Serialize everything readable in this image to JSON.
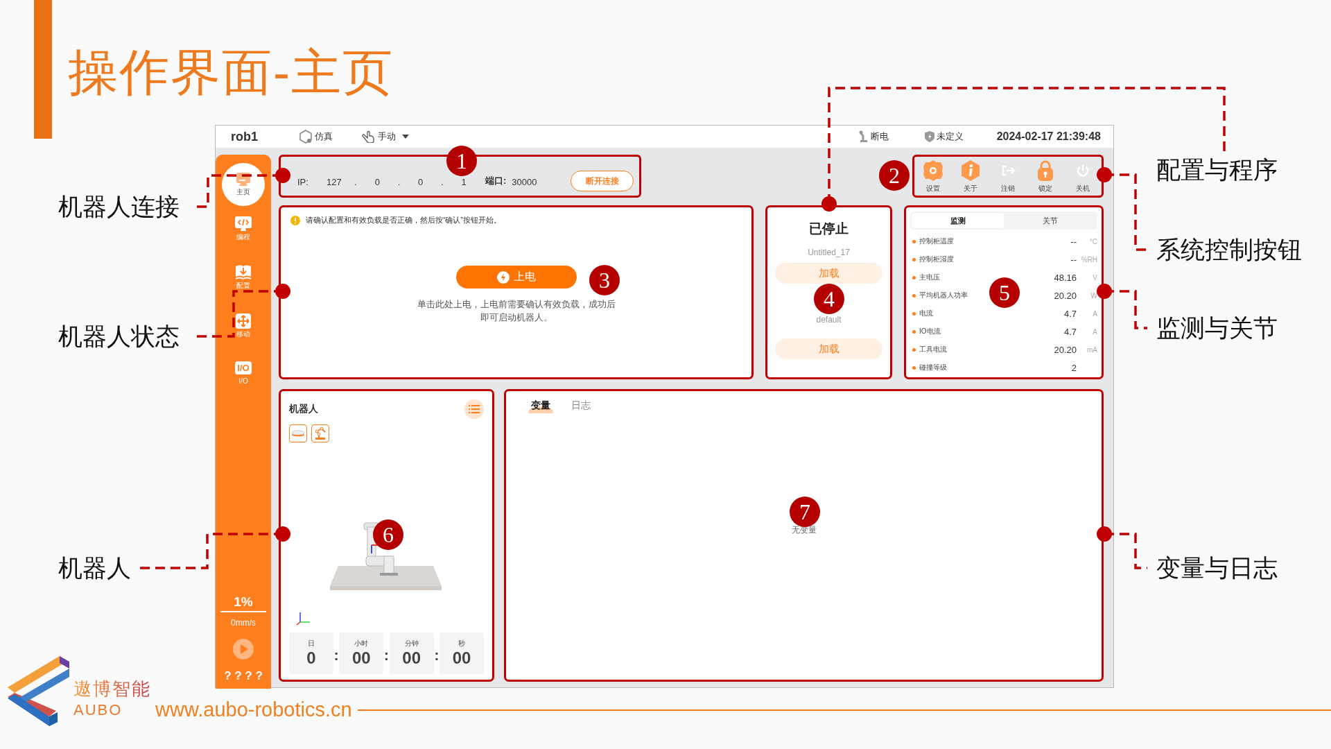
{
  "slide": {
    "title": "操作界面-主页",
    "brand_cn": "遨博智能",
    "brand_en": "AUBO",
    "website": "www.aubo-robotics.cn"
  },
  "annotations": [
    {
      "label": "机器人连接"
    },
    {
      "label": "机器人状态"
    },
    {
      "label": "机器人"
    },
    {
      "label": "配置与程序"
    },
    {
      "label": "系统控制按钮"
    },
    {
      "label": "监测与关节"
    },
    {
      "label": "变量与日志"
    }
  ],
  "markers": [
    "1",
    "2",
    "3",
    "4",
    "5",
    "6",
    "7"
  ],
  "topbar": {
    "robot": "rob1",
    "mode": "仿真",
    "control": "手动",
    "power": "断电",
    "safety": "未定义",
    "datetime": "2024-02-17 21:39:48"
  },
  "sidebar": {
    "items": [
      {
        "label": "主页",
        "kind": "home",
        "selected": true
      },
      {
        "label": "编程",
        "kind": "code",
        "selected": false
      },
      {
        "label": "配置",
        "kind": "config",
        "selected": false
      },
      {
        "label": "移动",
        "kind": "move",
        "selected": false
      },
      {
        "label": "I/O",
        "kind": "io",
        "glyph": "I/O",
        "selected": false
      }
    ],
    "speed": "1%",
    "velocity": "0mm/s",
    "status": "? ? ? ?"
  },
  "connection": {
    "ip_label": "IP:",
    "ip": [
      "127",
      "0",
      "0",
      "1"
    ],
    "separator": ".",
    "port_label": "端口:",
    "port": "30000",
    "button": "断开连接"
  },
  "system_buttons": [
    {
      "label": "设置",
      "kind": "settings"
    },
    {
      "label": "关于",
      "kind": "about"
    },
    {
      "label": "注销",
      "kind": "logout"
    },
    {
      "label": "锁定",
      "kind": "lock"
    },
    {
      "label": "关机",
      "kind": "power"
    }
  ],
  "power_card": {
    "notice": "请确认配置和有效负载是否正确，然后按“确认”按钮开始。",
    "button": "上电",
    "hint": "单击此处上电，上电前需要确认有效负载，成功后即可启动机器人。"
  },
  "program_card": {
    "status": "已停止",
    "program": "Untitled_17",
    "load_program": "加载",
    "config": "default",
    "load_config": "加载"
  },
  "monitor": {
    "tabs": [
      {
        "label": "监测",
        "selected": true
      },
      {
        "label": "关节",
        "selected": false
      }
    ],
    "rows": [
      {
        "name": "控制柜温度",
        "value": "--",
        "unit": "°C"
      },
      {
        "name": "控制柜湿度",
        "value": "--",
        "unit": "%RH"
      },
      {
        "name": "主电压",
        "value": "48.16",
        "unit": "V"
      },
      {
        "name": "平均机器人功率",
        "value": "20.20",
        "unit": "W"
      },
      {
        "name": "电流",
        "value": "4.7",
        "unit": "A"
      },
      {
        "name": "IO电流",
        "value": "4.7",
        "unit": "A"
      },
      {
        "name": "工具电流",
        "value": "20.20",
        "unit": "mA"
      },
      {
        "name": "碰撞等级",
        "value": "2"
      }
    ]
  },
  "robot_card": {
    "title": "机器人",
    "view_buttons": [
      {
        "kind": "base"
      },
      {
        "kind": "robot"
      }
    ],
    "timer": {
      "separator": ":",
      "units": [
        {
          "label": "日",
          "value": "0"
        },
        {
          "label": "小时",
          "value": "00"
        },
        {
          "label": "分钟",
          "value": "00"
        },
        {
          "label": "秒",
          "value": "00"
        }
      ]
    }
  },
  "variables_card": {
    "tabs": [
      {
        "label": "变量",
        "selected": true
      },
      {
        "label": "日志",
        "selected": false
      }
    ],
    "empty": "无变量"
  }
}
